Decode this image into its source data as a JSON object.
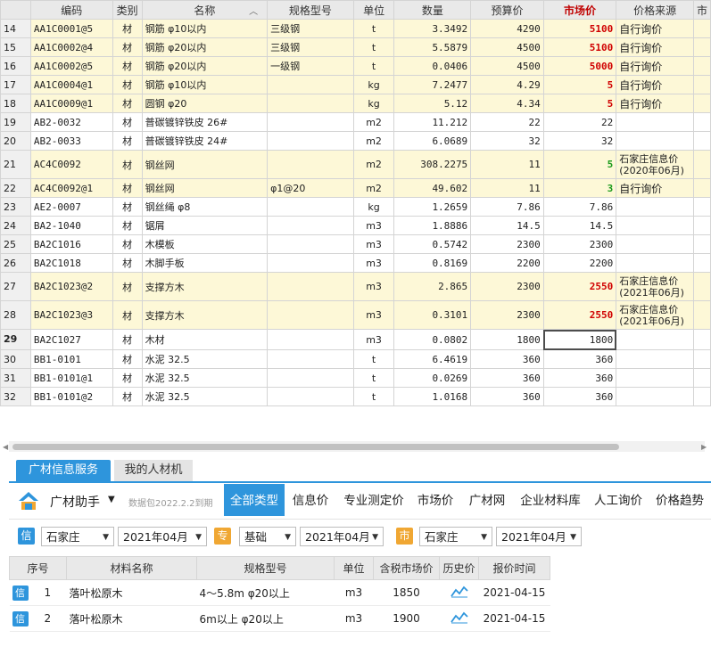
{
  "grid": {
    "headers": [
      "编码",
      "类别",
      "名称",
      "规格型号",
      "单位",
      "数量",
      "预算价",
      "市场价",
      "价格来源",
      "市"
    ],
    "sort_icon": "chevron-up-icon",
    "rows": [
      {
        "no": "14",
        "code": "AA1C0001@5",
        "cat": "材",
        "name": "钢筋 φ10以内",
        "spec": "三级钢",
        "unit": "t",
        "qty": "3.3492",
        "budget": "4290",
        "market": "5100",
        "src": "自行询价",
        "hl": true,
        "mc": "red"
      },
      {
        "no": "15",
        "code": "AA1C0002@4",
        "cat": "材",
        "name": "钢筋 φ20以内",
        "spec": "三级钢",
        "unit": "t",
        "qty": "5.5879",
        "budget": "4500",
        "market": "5100",
        "src": "自行询价",
        "hl": true,
        "mc": "red"
      },
      {
        "no": "16",
        "code": "AA1C0002@5",
        "cat": "材",
        "name": "钢筋 φ20以内",
        "spec": "一级钢",
        "unit": "t",
        "qty": "0.0406",
        "budget": "4500",
        "market": "5000",
        "src": "自行询价",
        "hl": true,
        "mc": "red"
      },
      {
        "no": "17",
        "code": "AA1C0004@1",
        "cat": "材",
        "name": "钢筋 φ10以内",
        "spec": "",
        "unit": "kg",
        "qty": "7.2477",
        "budget": "4.29",
        "market": "5",
        "src": "自行询价",
        "hl": true,
        "mc": "red"
      },
      {
        "no": "18",
        "code": "AA1C0009@1",
        "cat": "材",
        "name": "圆钢 φ20",
        "spec": "",
        "unit": "kg",
        "qty": "5.12",
        "budget": "4.34",
        "market": "5",
        "src": "自行询价",
        "hl": true,
        "mc": "red"
      },
      {
        "no": "19",
        "code": "AB2-0032",
        "cat": "材",
        "name": "普碳镀锌铁皮 26#",
        "spec": "",
        "unit": "m2",
        "qty": "11.212",
        "budget": "22",
        "market": "22",
        "src": "",
        "hl": false,
        "mc": ""
      },
      {
        "no": "20",
        "code": "AB2-0033",
        "cat": "材",
        "name": "普碳镀锌铁皮 24#",
        "spec": "",
        "unit": "m2",
        "qty": "6.0689",
        "budget": "32",
        "market": "32",
        "src": "",
        "hl": false,
        "mc": ""
      },
      {
        "no": "21",
        "code": "AC4C0092",
        "cat": "材",
        "name": "钢丝网",
        "spec": "",
        "unit": "m2",
        "qty": "308.2275",
        "budget": "11",
        "market": "5",
        "src": "石家庄信息价",
        "src2": "(2020年06月)",
        "hl": true,
        "mc": "green",
        "tall": true
      },
      {
        "no": "22",
        "code": "AC4C0092@1",
        "cat": "材",
        "name": "钢丝网",
        "spec": "φ1@20",
        "unit": "m2",
        "qty": "49.602",
        "budget": "11",
        "market": "3",
        "src": "自行询价",
        "hl": true,
        "mc": "green"
      },
      {
        "no": "23",
        "code": "AE2-0007",
        "cat": "材",
        "name": "钢丝绳 φ8",
        "spec": "",
        "unit": "kg",
        "qty": "1.2659",
        "budget": "7.86",
        "market": "7.86",
        "src": "",
        "hl": false,
        "mc": ""
      },
      {
        "no": "24",
        "code": "BA2-1040",
        "cat": "材",
        "name": "锯屑",
        "spec": "",
        "unit": "m3",
        "qty": "1.8886",
        "budget": "14.5",
        "market": "14.5",
        "src": "",
        "hl": false,
        "mc": ""
      },
      {
        "no": "25",
        "code": "BA2C1016",
        "cat": "材",
        "name": "木模板",
        "spec": "",
        "unit": "m3",
        "qty": "0.5742",
        "budget": "2300",
        "market": "2300",
        "src": "",
        "hl": false,
        "mc": ""
      },
      {
        "no": "26",
        "code": "BA2C1018",
        "cat": "材",
        "name": "木脚手板",
        "spec": "",
        "unit": "m3",
        "qty": "0.8169",
        "budget": "2200",
        "market": "2200",
        "src": "",
        "hl": false,
        "mc": ""
      },
      {
        "no": "27",
        "code": "BA2C1023@2",
        "cat": "材",
        "name": "支撑方木",
        "spec": "",
        "unit": "m3",
        "qty": "2.865",
        "budget": "2300",
        "market": "2550",
        "src": "石家庄信息价",
        "src2": "(2021年06月)",
        "hl": true,
        "mc": "red",
        "tall": true
      },
      {
        "no": "28",
        "code": "BA2C1023@3",
        "cat": "材",
        "name": "支撑方木",
        "spec": "",
        "unit": "m3",
        "qty": "0.3101",
        "budget": "2300",
        "market": "2550",
        "src": "石家庄信息价",
        "src2": "(2021年06月)",
        "hl": true,
        "mc": "red",
        "tall": true
      },
      {
        "no": "29",
        "code": "BA2C1027",
        "cat": "材",
        "name": "木材",
        "spec": "",
        "unit": "m3",
        "qty": "0.0802",
        "budget": "1800",
        "market": "1800",
        "src": "",
        "hl": false,
        "mc": "",
        "current": true
      },
      {
        "no": "30",
        "code": "BB1-0101",
        "cat": "材",
        "name": "水泥 32.5",
        "spec": "",
        "unit": "t",
        "qty": "6.4619",
        "budget": "360",
        "market": "360",
        "src": "",
        "hl": false,
        "mc": ""
      },
      {
        "no": "31",
        "code": "BB1-0101@1",
        "cat": "材",
        "name": "水泥 32.5",
        "spec": "",
        "unit": "t",
        "qty": "0.0269",
        "budget": "360",
        "market": "360",
        "src": "",
        "hl": false,
        "mc": ""
      },
      {
        "no": "32",
        "code": "BB1-0101@2",
        "cat": "材",
        "name": "水泥 32.5",
        "spec": "",
        "unit": "t",
        "qty": "1.0168",
        "budget": "360",
        "market": "360",
        "src": "",
        "hl": false,
        "mc": ""
      }
    ]
  },
  "panel": {
    "tabs": [
      "广材信息服务",
      "我的人材机"
    ],
    "brand": "广材助手",
    "package_note": "数据包2022.2.2到期",
    "categories": [
      "全部类型",
      "信息价",
      "专业测定价",
      "市场价",
      "广材网",
      "企业材料库",
      "人工询价",
      "价格趋势"
    ],
    "filters": {
      "badge_xin": "信",
      "region1": "石家庄",
      "date1": "2021年04月",
      "badge_zhuan": "专",
      "type2": "基础",
      "date2": "2021年04月",
      "badge_shi": "市",
      "region3": "石家庄",
      "date3": "2021年04月"
    },
    "headers": [
      "序号",
      "材料名称",
      "规格型号",
      "单位",
      "含税市场价",
      "历史价",
      "报价时间"
    ],
    "rows": [
      {
        "badge": "信",
        "no": "1",
        "name": "落叶松原木",
        "spec": "4～5.8m φ20以上",
        "unit": "m3",
        "price": "1850",
        "date": "2021-04-15"
      },
      {
        "badge": "信",
        "no": "2",
        "name": "落叶松原木",
        "spec": "6m以上 φ20以上",
        "unit": "m3",
        "price": "1900",
        "date": "2021-04-15"
      }
    ]
  },
  "colors": {
    "accent": "#2e95dc",
    "highlight_row": "#fdf8d7",
    "price_up": "#d00000",
    "price_down": "#1a9a1a",
    "badge_orange": "#f0a733"
  }
}
